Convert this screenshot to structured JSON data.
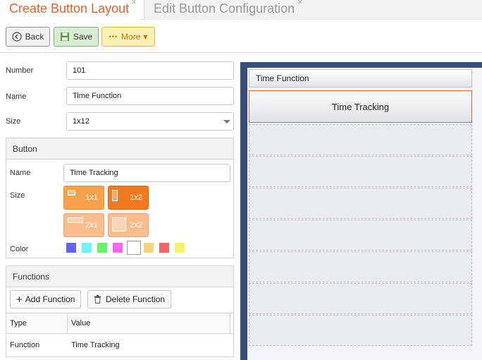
{
  "tabs": {
    "active": "Create Button Layout",
    "inactive": "Edit Button Configuration",
    "close_glyph": "×"
  },
  "toolbar": {
    "back_label": "Back",
    "save_label": "Save",
    "more_label": "More",
    "more_dots": "•••",
    "more_caret": "▾"
  },
  "form": {
    "number_label": "Number",
    "number_value": "101",
    "name_label": "Name",
    "name_value": "Time Function",
    "size_label": "Size",
    "size_value": "1x12"
  },
  "button_panel": {
    "title": "Button",
    "name_label": "Name",
    "name_value": "Time Tracking",
    "size_label": "Size",
    "sizes": [
      "1x1",
      "1x2",
      "2x1",
      "2x2"
    ],
    "selected_size": "1x2",
    "color_label": "Color",
    "colors": [
      "#6464f4",
      "#6ef4f4",
      "#68f468",
      "#f468f4",
      "#ffffff",
      "#f9d280",
      "#f46468",
      "#f4f468"
    ],
    "selected_color": "#ffffff"
  },
  "functions_panel": {
    "title": "Functions",
    "add_label": "Add Function",
    "delete_label": "Delete Function",
    "columns": [
      "Type",
      "Value"
    ],
    "rows": [
      {
        "type": "Function",
        "value": "Time Tracking"
      }
    ]
  },
  "preview": {
    "title": "Time Function",
    "selected_button": "Time Tracking",
    "empty_slot_count": 7
  },
  "icons": {
    "back": "circle-left-icon",
    "save": "floppy-disk-icon",
    "add": "plus-icon",
    "delete": "trash-icon"
  }
}
